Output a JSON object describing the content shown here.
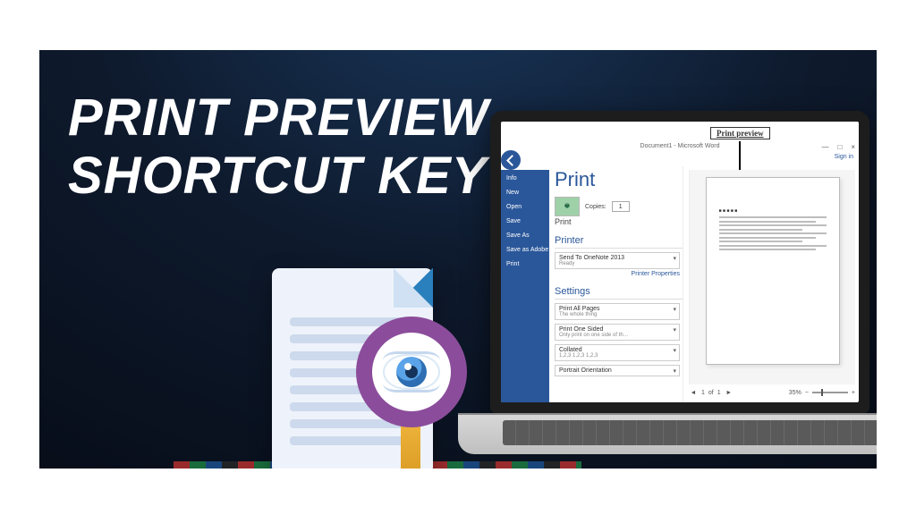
{
  "headline": {
    "line1": "PRINT PREVIEW",
    "line2": "SHORTCUT KEY"
  },
  "callout": "Print preview",
  "word": {
    "title": "Document1 - Microsoft Word",
    "signin": "Sign in",
    "win": {
      "min": "—",
      "max": "□",
      "close": "×"
    },
    "sidebar": [
      "Info",
      "New",
      "Open",
      "Save",
      "Save As",
      "Save as Adobe PDF",
      "Print"
    ],
    "print_heading": "Print",
    "copies_label": "Copies:",
    "copies_value": "1",
    "print_button": "Print",
    "printer_heading": "Printer",
    "printer_name": "Send To OneNote 2013",
    "printer_status": "Ready",
    "printer_properties": "Printer Properties",
    "settings_heading": "Settings",
    "setting_pages": {
      "title": "Print All Pages",
      "sub": "The whole thing"
    },
    "setting_sided": {
      "title": "Print One Sided",
      "sub": "Only print on one side of th…"
    },
    "setting_collated": {
      "title": "Collated",
      "sub": "1,2,3   1,2,3   1,2,3"
    },
    "setting_orient": {
      "title": "Portrait Orientation",
      "sub": ""
    },
    "status": {
      "page_current": "1",
      "page_of": "of",
      "page_total": "1",
      "zoom": "35%",
      "minus": "−",
      "plus": "+"
    }
  }
}
